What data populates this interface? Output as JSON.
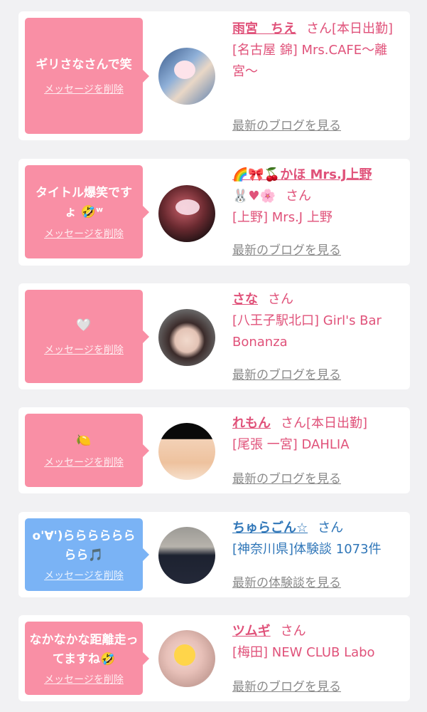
{
  "items": [
    {
      "message": "ギリさなさんで笑",
      "delete_label": "メッセージを削除",
      "name": "雨宮　ちえ",
      "suffix": "さん[本日出勤]",
      "shop": "[名古屋 錦] Mrs.CAFE～離宮～",
      "link": "最新のブログを見る"
    },
    {
      "message": "タイトル爆笑です\nょ 🤣ʷ",
      "delete_label": "メッセージを削除",
      "name": "🌈🎀🍒かほ Mrs.J上野",
      "name2": "🐰♥🌸",
      "suffix": "さん",
      "shop": "[上野] Mrs.J 上野",
      "link": "最新のブログを見る"
    },
    {
      "message": "🤍",
      "delete_label": "メッセージを削除",
      "name": "さな",
      "suffix": "さん",
      "shop": "[八王子駅北口] Girl's Bar Bonanza",
      "link": "最新のブログを見る"
    },
    {
      "message": "🍋",
      "delete_label": "メッセージを削除",
      "name": "れもん",
      "suffix": "さん[本日出勤]",
      "shop": "[尾張 一宮] DAHLIA",
      "link": "最新のブログを見る"
    },
    {
      "message": "o'∀')らららららららら🎵",
      "delete_label": "メッセージを削除",
      "name": "ちゅらごん☆",
      "suffix": "さん",
      "shop": "[神奈川県]体験談 1073件",
      "link": "最新の体験談を見る"
    },
    {
      "message": "なかなかな距離走ってますね🤣",
      "delete_label": "メッセージを削除",
      "name": "ツムギ",
      "suffix": "さん",
      "shop": "[梅田] NEW CLUB Labo",
      "link": "最新のブログを見る"
    }
  ],
  "colors": {
    "pink_bubble": "#f98fa5",
    "blue_bubble": "#7ab3f5",
    "pink_text": "#e0527a",
    "blue_text": "#2f76b8",
    "link_gray": "#8a8a8a"
  }
}
